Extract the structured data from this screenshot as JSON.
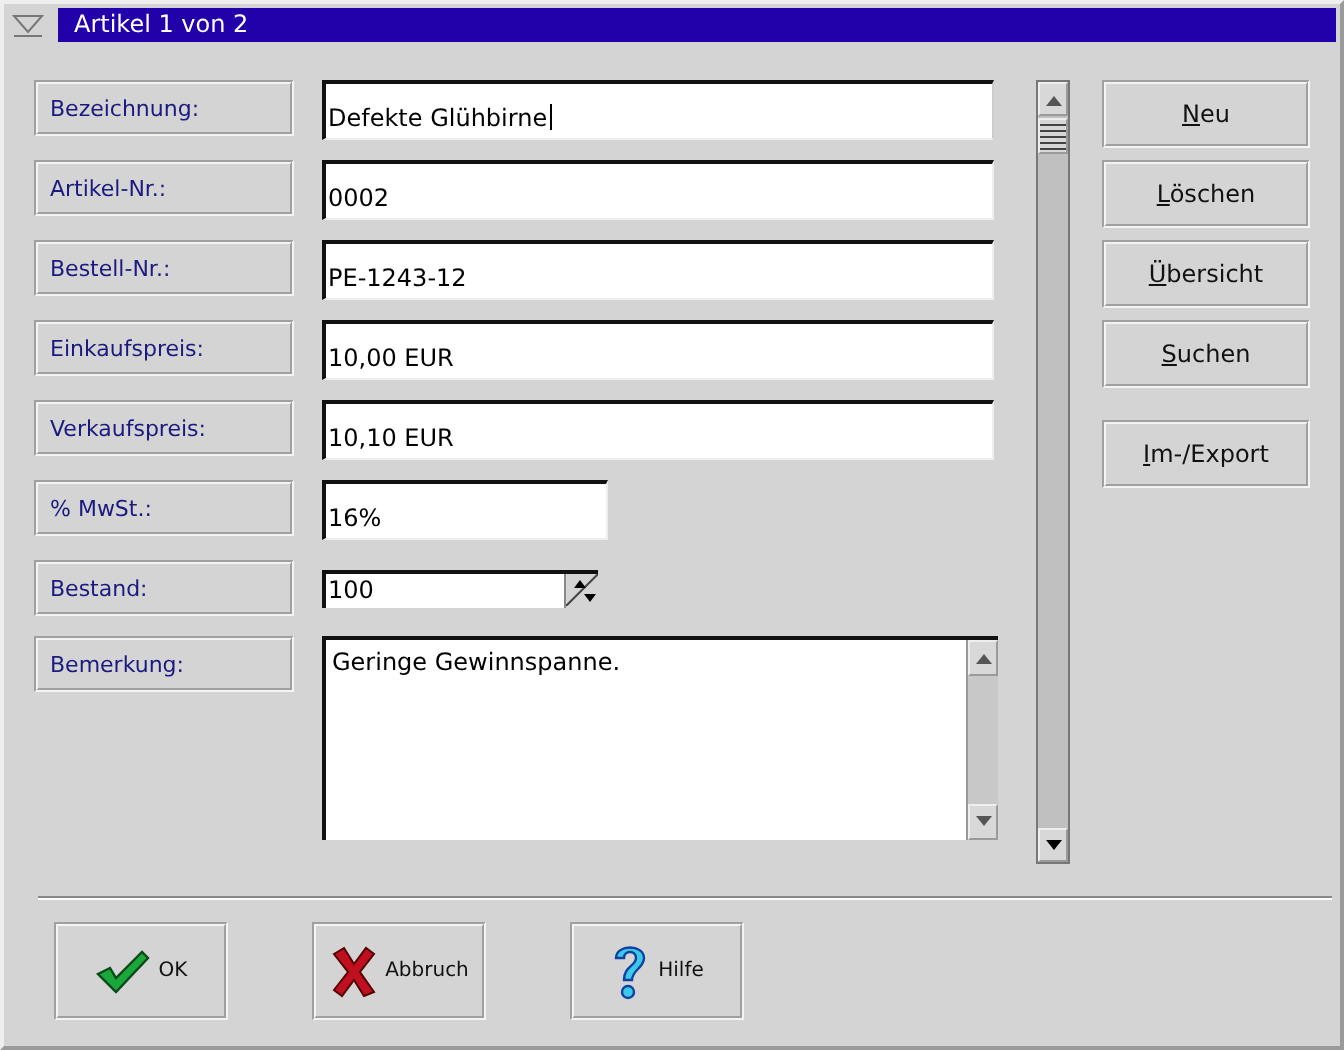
{
  "window": {
    "title": "Artikel 1 von 2"
  },
  "fields": [
    {
      "label": "Bezeichnung:",
      "kind": "text",
      "value": "Defekte Glühbirne",
      "focused": true
    },
    {
      "label": "Artikel-Nr.:",
      "kind": "text",
      "value": "0002",
      "focused": false
    },
    {
      "label": "Bestell-Nr.:",
      "kind": "text",
      "value": "PE-1243-12",
      "focused": false
    },
    {
      "label": "Einkaufspreis:",
      "kind": "text",
      "value": "10,00 EUR",
      "focused": false
    },
    {
      "label": "Verkaufspreis:",
      "kind": "text",
      "value": "10,10 EUR",
      "focused": false
    },
    {
      "label": "% MwSt.:",
      "kind": "short",
      "value": "16%",
      "focused": false
    },
    {
      "label": "Bestand:",
      "kind": "spin",
      "value": "100",
      "focused": false
    },
    {
      "label": "Bemerkung:",
      "kind": "memo",
      "value": "Geringe Gewinnspanne.",
      "focused": false
    }
  ],
  "side_buttons": [
    {
      "label": "Neu",
      "underline_first": true
    },
    {
      "label": "Löschen",
      "underline_first": true
    },
    {
      "label": "Übersicht",
      "underline_first": true
    },
    {
      "label": "Suchen",
      "underline_first": true
    },
    {
      "label": "Im-/Export",
      "underline_first": true
    }
  ],
  "bottom_buttons": [
    {
      "label": "OK"
    },
    {
      "label": "Abbruch"
    },
    {
      "label": "Hilfe"
    }
  ]
}
